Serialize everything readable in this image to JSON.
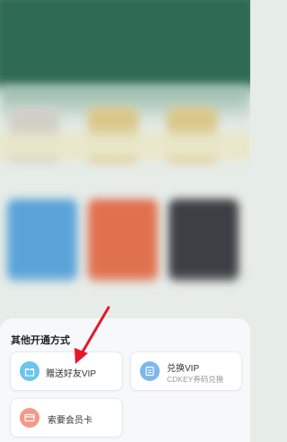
{
  "sheet": {
    "title": "其他开通方式",
    "options": [
      {
        "label": "赠送好友VIP",
        "icon": "gift-icon",
        "icon_color": "#6cc5ea"
      },
      {
        "label": "兑换VIP",
        "sub": "CDKEY券码兑换",
        "icon": "voucher-icon",
        "icon_color": "#7db8ec"
      },
      {
        "label": "索要会员卡",
        "icon": "card-icon",
        "icon_color": "#f39a86"
      }
    ]
  },
  "colors": {
    "arrow": "#e4182a",
    "header": "#2f6b52"
  }
}
